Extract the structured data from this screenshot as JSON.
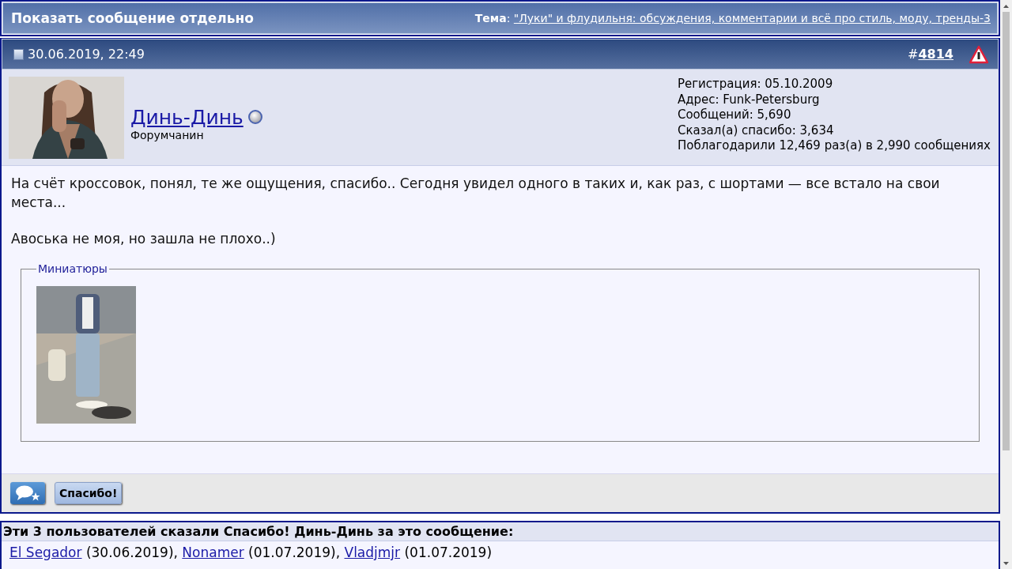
{
  "page_header": {
    "title": "Показать сообщение отдельно",
    "topic_label": "Тема",
    "topic_separator": ":",
    "topic_link": "\"Луки\" и флудильня: обсуждения, комментарии и всё про стиль, моду, тренды-3"
  },
  "post": {
    "date": "30.06.2019, 22:49",
    "number_prefix": "#",
    "number": "4814",
    "author": {
      "name": "Динь-Динь",
      "online": false,
      "rank": "Форумчанин",
      "stats": [
        "Регистрация: 05.10.2009",
        "Адрес: Funk-Petersburg",
        "Сообщений: 5,690",
        "Сказал(а) спасибо: 3,634",
        "Поблагодарили 12,469 раз(а) в 2,990 сообщениях"
      ]
    },
    "paragraphs": [
      "На счёт кроссовок, понял, те же ощущения, спасибо.. Сегодня увидел одного в таких и, как раз, с шортами — все встало на свои места...",
      "Авоська не моя, но зашла не плохо..)"
    ],
    "attachments": {
      "legend": "Миниатюры"
    },
    "thanks_button": "Спасибо!"
  },
  "thanks": {
    "title": "Эти 3 пользователей сказали Спасибо! Динь-Динь за это сообщение:",
    "users": [
      {
        "name": "El Segador",
        "date": "(30.06.2019),"
      },
      {
        "name": "Nonamer",
        "date": "(01.07.2019),"
      },
      {
        "name": "Vladjmjr",
        "date": "(01.07.2019)"
      }
    ]
  }
}
